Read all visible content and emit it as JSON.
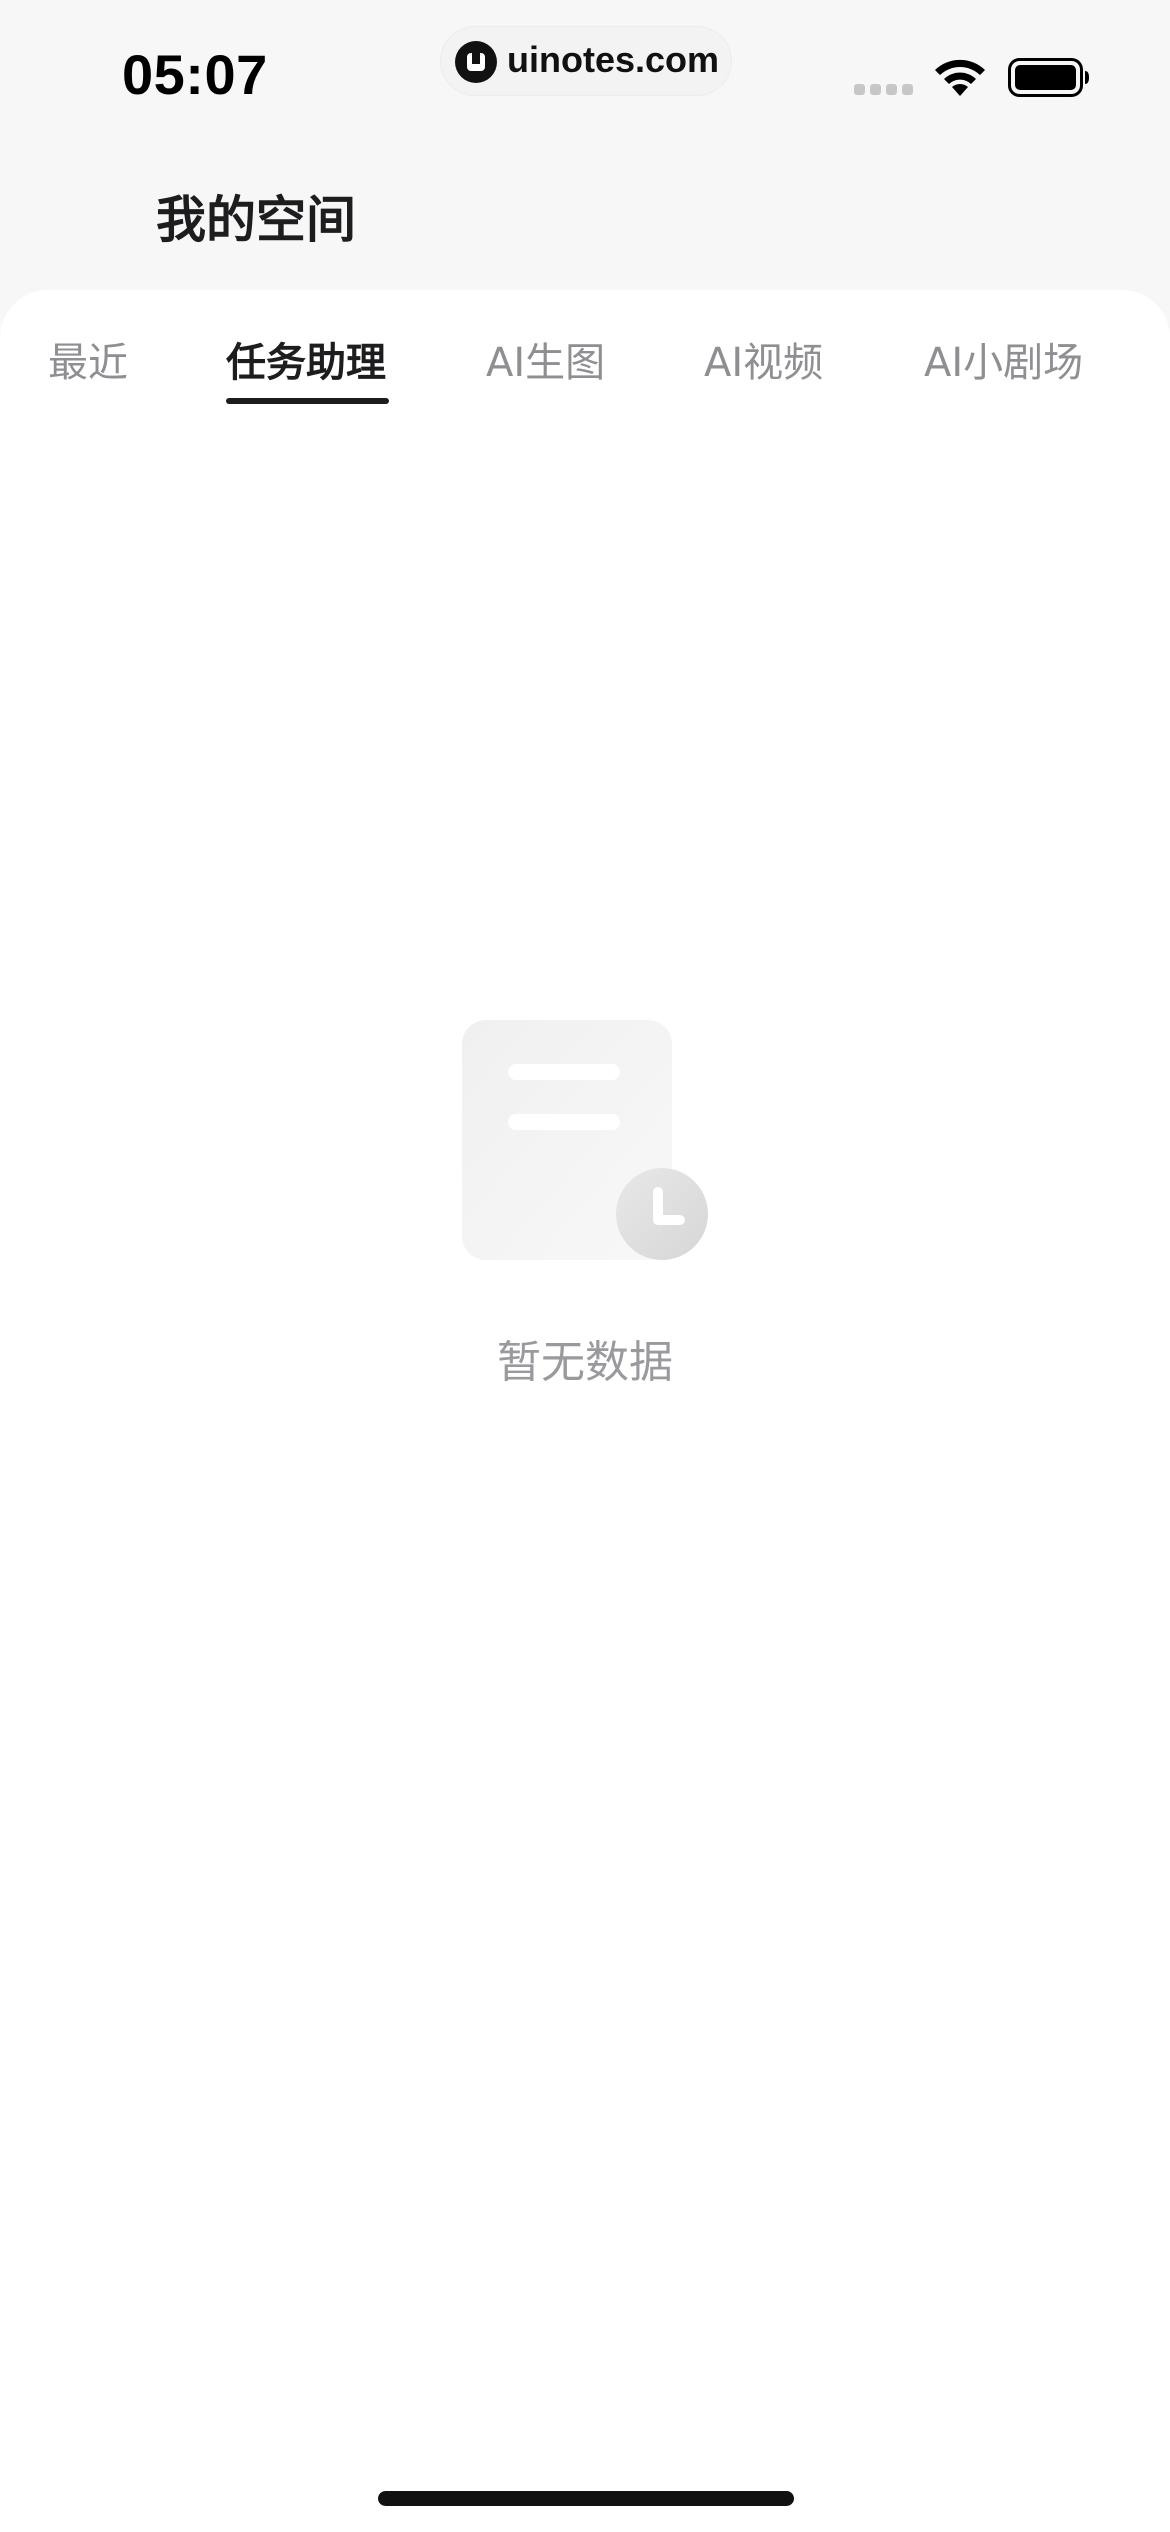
{
  "status_bar": {
    "time": "05:07",
    "site_label": "uinotes.com",
    "site_logo_icon": "uinotes-logo-icon",
    "signal_icon": "cellular-signal-icon",
    "wifi_icon": "wifi-icon",
    "battery_icon": "battery-icon"
  },
  "header": {
    "title": "我的空间"
  },
  "tabs": [
    {
      "label": "最近",
      "active": false
    },
    {
      "label": "任务助理",
      "active": true
    },
    {
      "label": "AI生图",
      "active": false
    },
    {
      "label": "AI视频",
      "active": false
    },
    {
      "label": "AI小剧场",
      "active": false
    }
  ],
  "empty_state": {
    "icon": "empty-document-clock-icon",
    "message": "暂无数据"
  },
  "colors": {
    "background": "#f7f7f7",
    "card": "#ffffff",
    "text_primary": "#1d1d1f",
    "text_secondary": "#8e8e93",
    "tab_indicator": "#1d1d1f"
  }
}
